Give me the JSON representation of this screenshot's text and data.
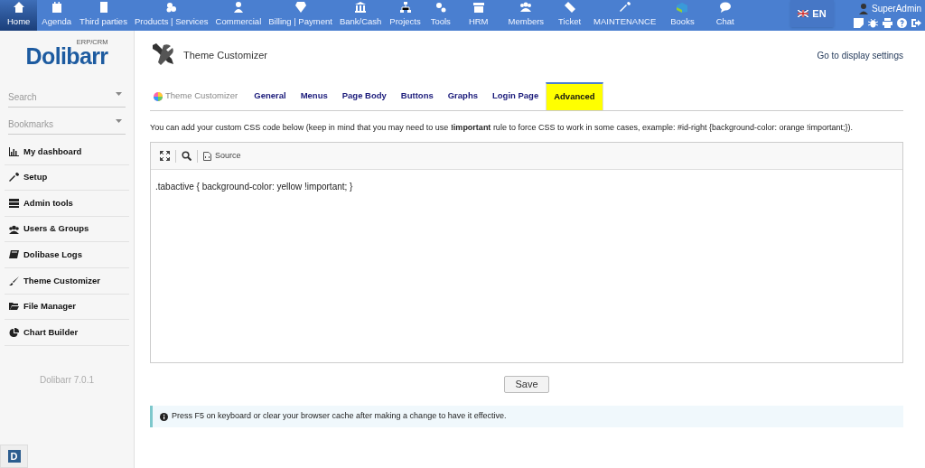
{
  "top_menu": [
    {
      "label": "Home",
      "selected": true
    },
    {
      "label": "Agenda",
      "selected": false
    },
    {
      "label": "Third parties",
      "selected": false
    },
    {
      "label": "Products | Services",
      "selected": false
    },
    {
      "label": "Commercial",
      "selected": false
    },
    {
      "label": "Billing | Payment",
      "selected": false
    },
    {
      "label": "Bank/Cash",
      "selected": false
    },
    {
      "label": "Projects",
      "selected": false
    },
    {
      "label": "Tools",
      "selected": false
    },
    {
      "label": "HRM",
      "selected": false
    },
    {
      "label": "Members",
      "selected": false
    },
    {
      "label": "Ticket",
      "selected": false
    },
    {
      "label": "MAINTENANCE",
      "selected": false
    },
    {
      "label": "Books",
      "selected": false
    },
    {
      "label": "Chat",
      "selected": false
    }
  ],
  "language": "EN",
  "user": "SuperAdmin",
  "logo": {
    "name": "Dolibarr",
    "tagline": "ERP/CRM"
  },
  "sidebar": {
    "search": {
      "placeholder": "Search"
    },
    "bookmarks": {
      "placeholder": "Bookmarks"
    },
    "items": [
      "My dashboard",
      "Setup",
      "Admin tools",
      "Users & Groups",
      "Dolibase Logs",
      "Theme Customizer",
      "File Manager",
      "Chart Builder"
    ],
    "version": "Dolibarr 7.0.1",
    "badge": "D"
  },
  "page": {
    "title": "Theme Customizer",
    "link": "Go to display settings",
    "tabs": [
      {
        "label": "Theme Customizer",
        "kind": "module",
        "selected": false
      },
      {
        "label": "General",
        "kind": "tab",
        "selected": false
      },
      {
        "label": "Menus",
        "kind": "tab",
        "selected": false
      },
      {
        "label": "Page Body",
        "kind": "tab",
        "selected": false
      },
      {
        "label": "Buttons",
        "kind": "tab",
        "selected": false
      },
      {
        "label": "Graphs",
        "kind": "tab",
        "selected": false
      },
      {
        "label": "Login Page",
        "kind": "tab",
        "selected": false
      },
      {
        "label": "Advanced",
        "kind": "tab",
        "selected": true
      }
    ],
    "description": "You can add your custom CSS code below (keep in mind that you may need to use **!important** rule to force CSS to work in some cases, example: #id-right {background-color: orange !important;}).",
    "editor": {
      "toolbar_source": "Source",
      "code": ".tabactive { background-color: yellow !important; }"
    },
    "save_button": "Save",
    "info": "Press F5 on keyboard or clear your browser cache after making a change to have it effective."
  }
}
